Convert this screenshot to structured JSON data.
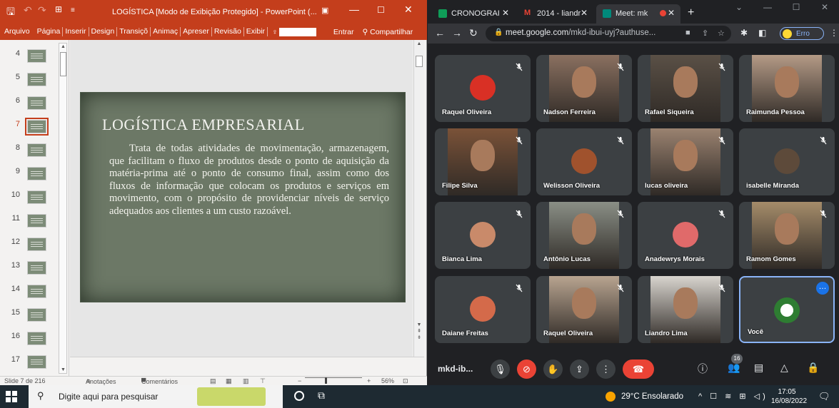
{
  "ppt": {
    "window_title": "LOGÍSTICA [Modo de Exibição Protegido] - PowerPoint (...",
    "ribbon_tabs": [
      "Arquivo",
      "Página",
      "Inserir",
      "Design",
      "Transiçõ",
      "Animaç",
      "Apreser",
      "Revisão",
      "Exibir"
    ],
    "tell_me_icon": "lightbulb-icon",
    "sign_in": "Entrar",
    "share": "Compartilhar",
    "thumbnails": [
      "4",
      "5",
      "6",
      "7",
      "8",
      "9",
      "10",
      "11",
      "12",
      "13",
      "14",
      "15",
      "16",
      "17"
    ],
    "selected_slide": "7",
    "slide": {
      "title": "LOGÍSTICA EMPRESARIAL",
      "body": "Trata de todas atividades de movimentação, armazenagem, que facilitam o fluxo de produtos desde o ponto de aquisição da matéria-prima até o ponto de consumo final, assim como dos fluxos de informação que colocam os produtos e serviços em movimento, com o propósito de providenciar níveis de serviço adequados aos clientes a um custo razoável."
    },
    "status": {
      "slide_count": "Slide 7 de 216",
      "notes": "Anotações",
      "comments": "Comentários",
      "zoom": "56%"
    }
  },
  "chrome": {
    "tabs": [
      {
        "label": "CRONOGRAI",
        "favicon_color": "#0f9d58",
        "active": false
      },
      {
        "label": "2014 - liandr",
        "favicon_color": "#ea4335",
        "active": false
      },
      {
        "label": "Meet: mk",
        "favicon_color": "#00897b",
        "active": true
      }
    ],
    "url_host": "meet.google.com",
    "url_path": "/mkd-ibui-uyj?authuse...",
    "profile_label": "Erro"
  },
  "meet": {
    "participants": [
      {
        "name": "Raquel Oliveira",
        "muted": true,
        "camera": false,
        "avatar_color": "#d93025"
      },
      {
        "name": "Nadson Ferreira",
        "muted": true,
        "camera": true,
        "video_color": "#8a7060"
      },
      {
        "name": "Rafael Siqueira",
        "muted": true,
        "camera": true,
        "video_color": "#5a5046"
      },
      {
        "name": "Raimunda Pessoa",
        "muted": false,
        "camera": true,
        "video_color": "#b49a86"
      },
      {
        "name": "Filipe Silva",
        "muted": true,
        "camera": true,
        "video_color": "#7a5238"
      },
      {
        "name": "Welisson Oliveira",
        "muted": true,
        "camera": false,
        "avatar_color": "#a0522d"
      },
      {
        "name": "lucas oliveira",
        "muted": true,
        "camera": true,
        "video_color": "#9a8270"
      },
      {
        "name": "isabelle Miranda",
        "muted": true,
        "camera": false,
        "avatar_color": "#5d4a3a"
      },
      {
        "name": "Bianca Lima",
        "muted": true,
        "camera": false,
        "avatar_color": "#c98a6a"
      },
      {
        "name": "Antônio Lucas",
        "muted": true,
        "camera": true,
        "video_color": "#8a8f86"
      },
      {
        "name": "Anadewrys Morais",
        "muted": true,
        "camera": false,
        "avatar_color": "#e06a6a"
      },
      {
        "name": "Ramom Gomes",
        "muted": true,
        "camera": true,
        "video_color": "#a58c6a"
      },
      {
        "name": "Daiane Freitas",
        "muted": true,
        "camera": false,
        "avatar_color": "#d46a4a"
      },
      {
        "name": "Raquel Oliveira",
        "muted": true,
        "camera": true,
        "video_color": "#b8a490"
      },
      {
        "name": "Liandro Lima",
        "muted": true,
        "camera": true,
        "video_color": "#d8d4ce"
      },
      {
        "name": "Você",
        "muted": false,
        "camera": false,
        "avatar_color": "#2e7d32"
      }
    ],
    "meeting_code": "mkd-ib...",
    "people_count": "16"
  },
  "taskbar": {
    "search_placeholder": "Digite aqui para pesquisar",
    "weather": "29°C  Ensolarado",
    "time": "17:05",
    "date": "16/08/2022"
  },
  "colors": {
    "ppt_accent": "#c43e1c",
    "meet_bg": "#202124",
    "end_call_red": "#ea4335"
  }
}
